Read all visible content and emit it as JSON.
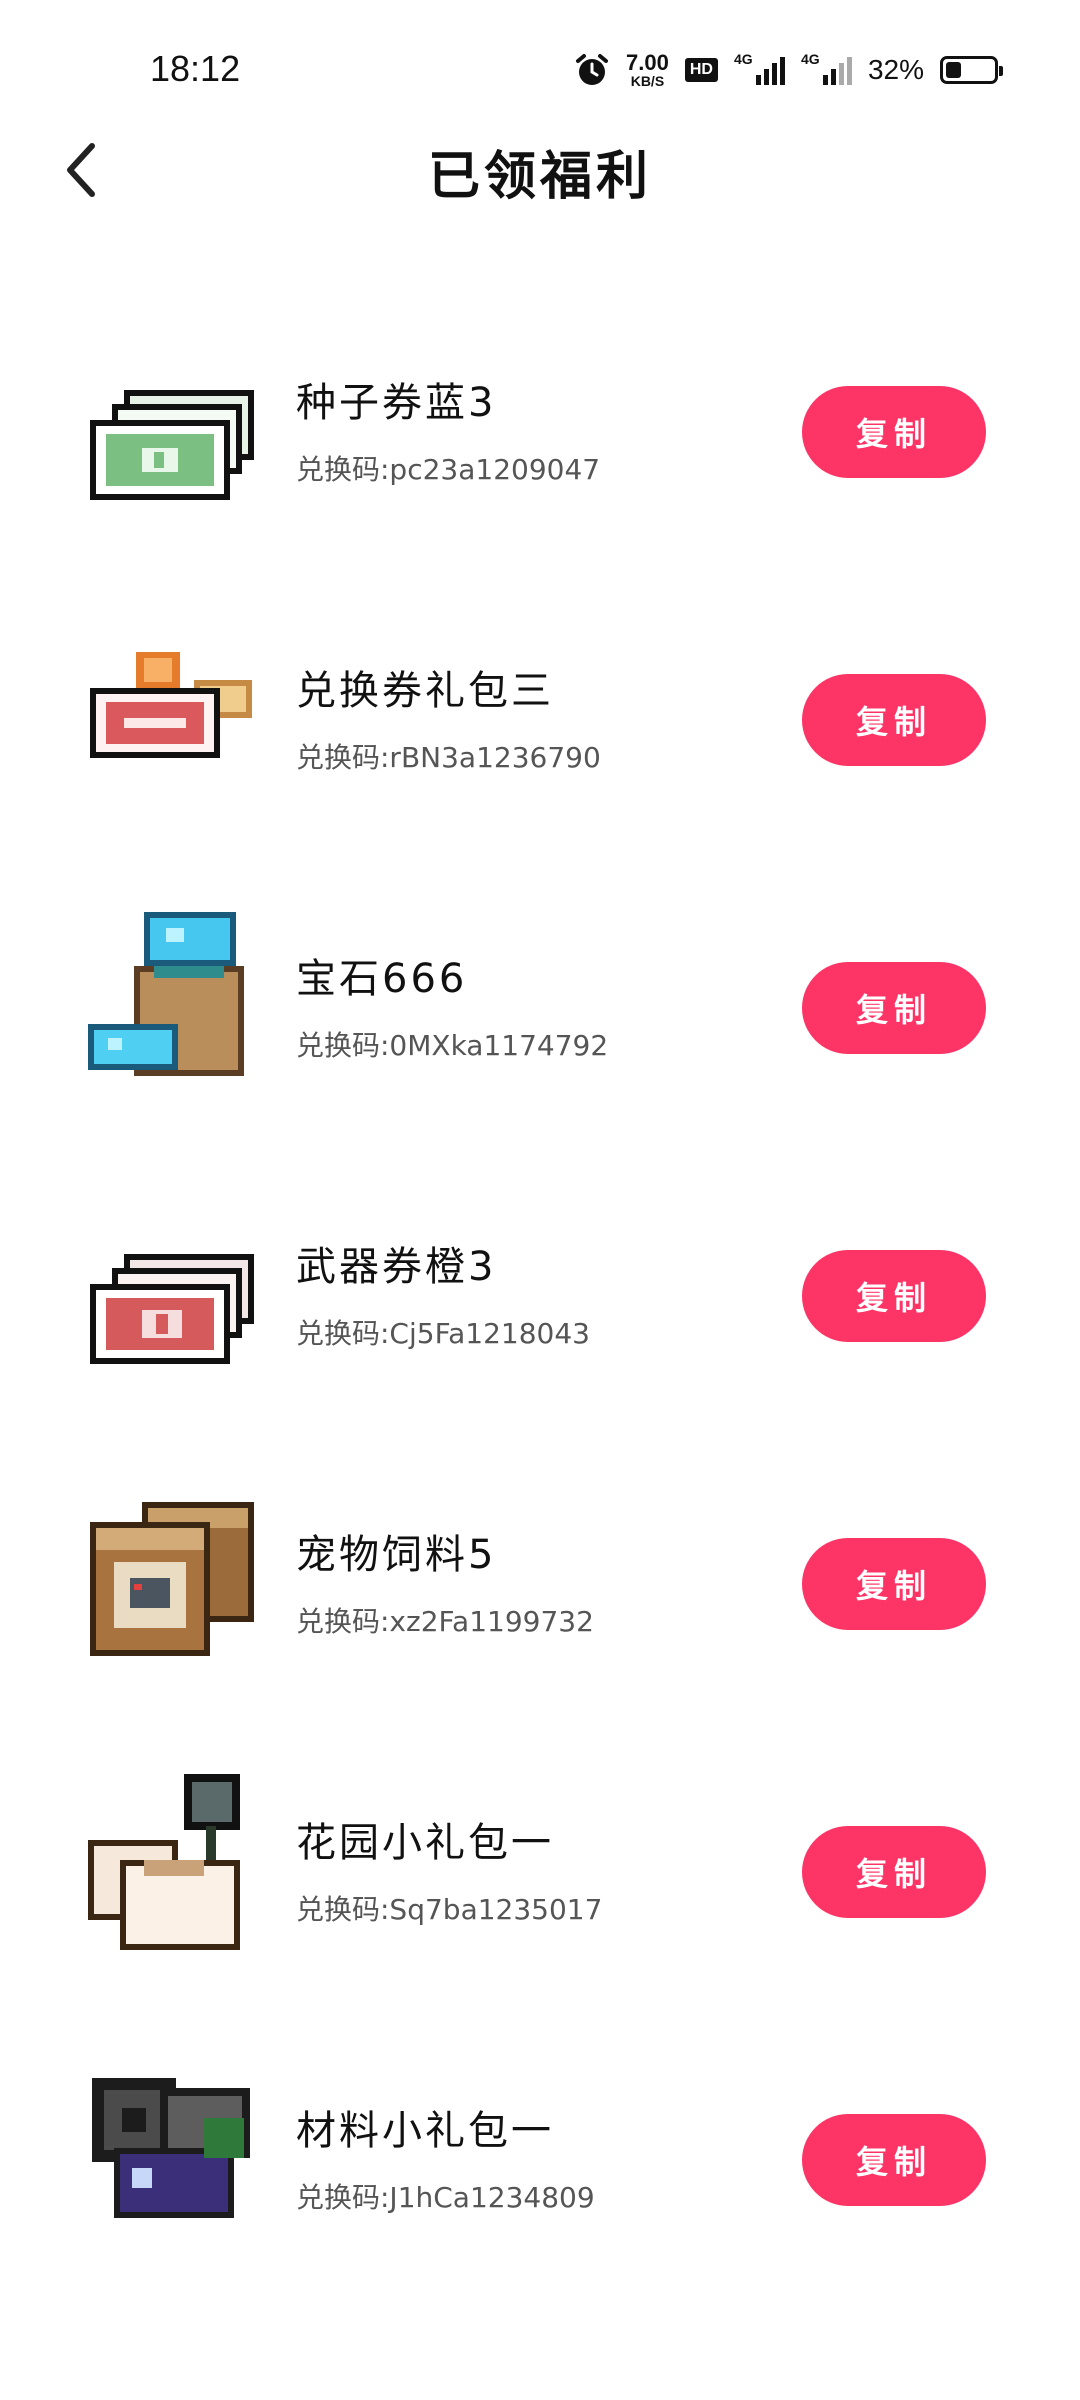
{
  "status_bar": {
    "time": "18:12",
    "net_speed": "7.00",
    "net_unit": "KB/S",
    "hd": "HD",
    "signal1_tag": "4G",
    "signal2_tag": "4G",
    "battery_percent": "32%",
    "battery_level": 0.32
  },
  "header": {
    "title": "已领福利",
    "back_icon": "chevron-left-icon"
  },
  "colors": {
    "accent": "#fc3566",
    "text_primary": "#111111",
    "text_secondary": "#555555"
  },
  "items": [
    {
      "name": "种子券蓝3",
      "code": "兑换码:pc23a1209047",
      "button": "复制",
      "icon": "seed-ticket-icon"
    },
    {
      "name": "兑换券礼包三",
      "code": "兑换码:rBN3a1236790",
      "button": "复制",
      "icon": "exchange-ticket-icon"
    },
    {
      "name": "宝石666",
      "code": "兑换码:0MXka1174792",
      "button": "复制",
      "icon": "gem-bag-icon"
    },
    {
      "name": "武器券橙3",
      "code": "兑换码:Cj5Fa1218043",
      "button": "复制",
      "icon": "weapon-ticket-icon"
    },
    {
      "name": "宠物饲料5",
      "code": "兑换码:xz2Fa1199732",
      "button": "复制",
      "icon": "pet-food-icon"
    },
    {
      "name": "花园小礼包一",
      "code": "兑换码:Sq7ba1235017",
      "button": "复制",
      "icon": "garden-pack-icon"
    },
    {
      "name": "材料小礼包一",
      "code": "兑换码:J1hCa1234809",
      "button": "复制",
      "icon": "material-pack-icon"
    }
  ]
}
